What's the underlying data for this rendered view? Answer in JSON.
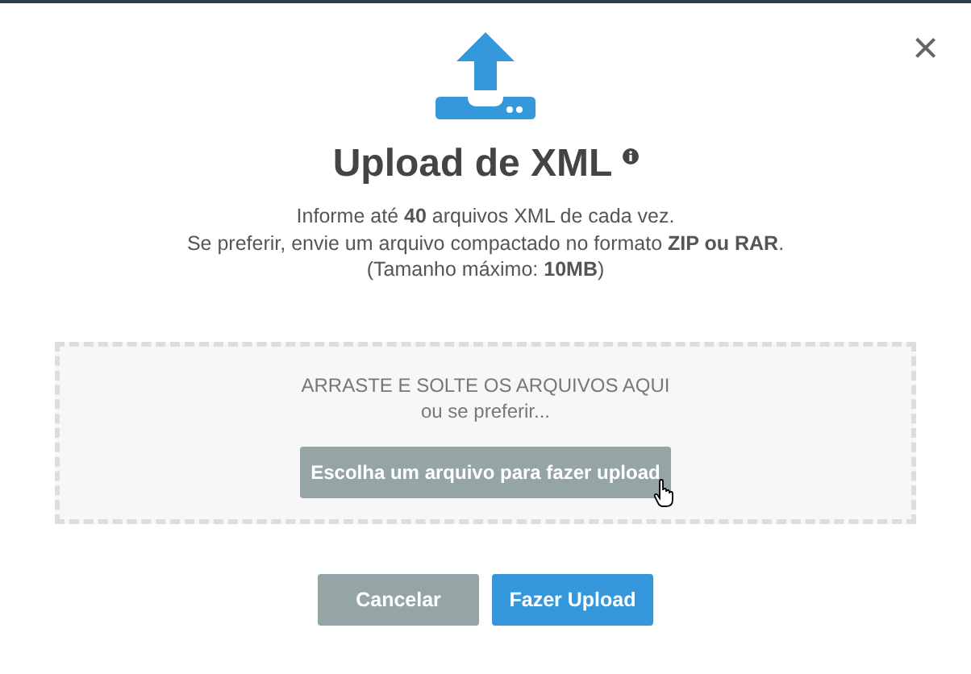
{
  "dialog": {
    "title": "Upload de XML",
    "close_label": "×",
    "description": [
      "Informe até **40** arquivos XML de cada vez.",
      "Se preferir, envie um arquivo compactado no formato **ZIP ou RAR**.",
      "(Tamanho máximo: **10MB**)"
    ],
    "dropzone": {
      "heading": "ARRASTE E SOLTE OS ARQUIVOS AQUI",
      "subtext": "ou se preferir...",
      "button": "Escolha um arquivo para fazer upload"
    },
    "buttons": [
      {
        "label": "Cancelar",
        "kind": "secondary"
      },
      {
        "label": "Fazer Upload",
        "kind": "primary"
      }
    ]
  }
}
